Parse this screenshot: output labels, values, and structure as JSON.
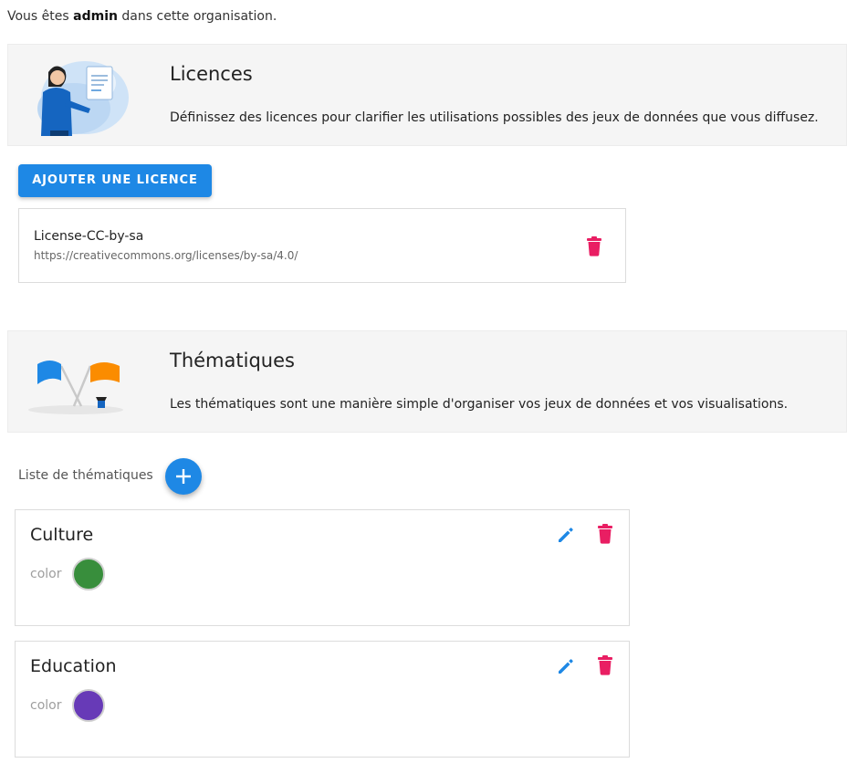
{
  "header": {
    "prefix": "Vous êtes ",
    "role": "admin",
    "suffix": " dans cette organisation."
  },
  "licences": {
    "title": "Licences",
    "description": "Définissez des licences pour clarifier les utilisations possibles des jeux de données que vous diffusez.",
    "add_button_label": "AJOUTER UNE LICENCE",
    "items": [
      {
        "name": "License-CC-by-sa",
        "url": "https://creativecommons.org/licenses/by-sa/4.0/"
      }
    ]
  },
  "thematiques": {
    "title": "Thématiques",
    "description": "Les thématiques sont une manière simple d'organiser vos jeux de données et vos visualisations.",
    "list_label": "Liste de thématiques",
    "color_label": "color",
    "items": [
      {
        "name": "Culture",
        "color": "#388e3c"
      },
      {
        "name": "Education",
        "color": "#673ab7"
      }
    ]
  },
  "colors": {
    "primary": "#1e88e5",
    "danger": "#e91e63",
    "edit": "#1e88e5"
  },
  "icons": {
    "add": "plus-icon",
    "delete": "trash-icon",
    "edit": "pencil-icon"
  }
}
